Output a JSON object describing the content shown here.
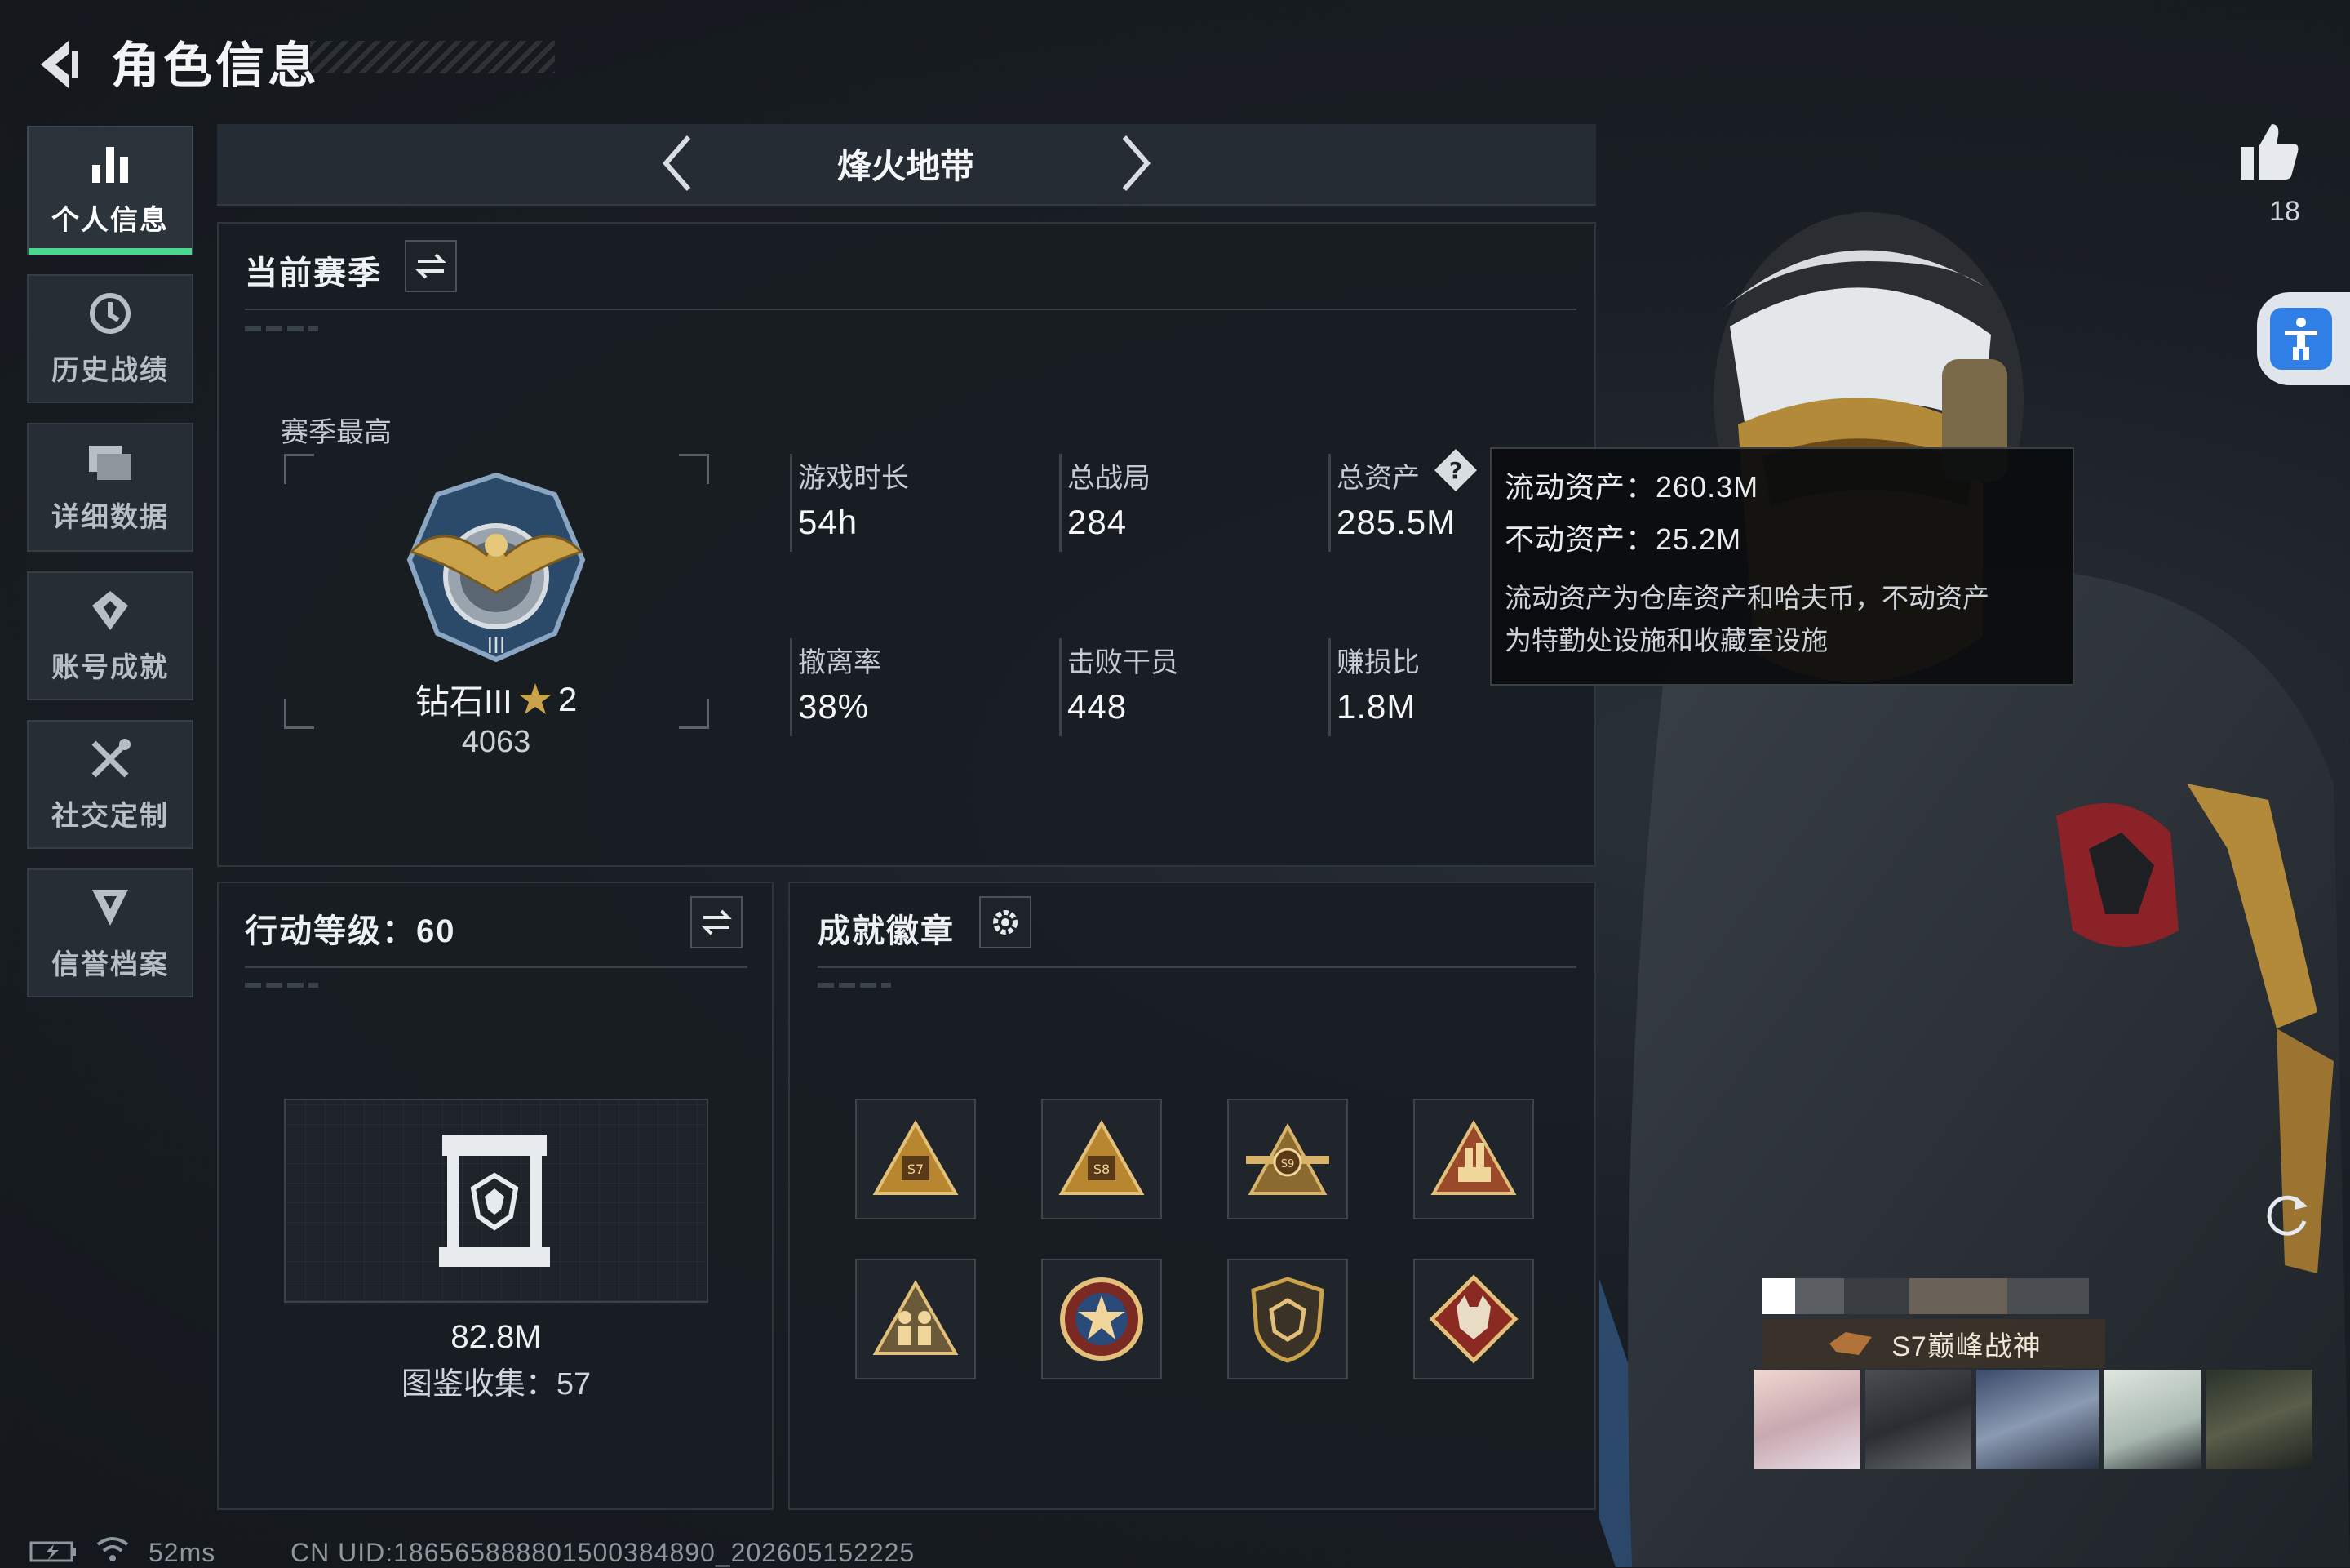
{
  "header": {
    "title": "角色信息"
  },
  "sidebar": {
    "items": [
      {
        "label": "个人信息",
        "icon": "bar-chart-icon",
        "active": true
      },
      {
        "label": "历史战绩",
        "icon": "history-icon",
        "active": false
      },
      {
        "label": "详细数据",
        "icon": "folder-icon",
        "active": false
      },
      {
        "label": "账号成就",
        "icon": "achievement-icon",
        "active": false
      },
      {
        "label": "社交定制",
        "icon": "tools-icon",
        "active": false
      },
      {
        "label": "信誉档案",
        "icon": "credit-icon",
        "active": false
      }
    ]
  },
  "mode_selector": {
    "current": "烽火地带"
  },
  "season_panel": {
    "title": "当前赛季",
    "highest_label": "赛季最高",
    "rank_name": "钻石III",
    "rank_stars": "2",
    "rank_points": "4063",
    "stats": [
      {
        "label": "游戏时长",
        "value": "54h"
      },
      {
        "label": "总战局",
        "value": "284"
      },
      {
        "label": "总资产",
        "value": "285.5M"
      },
      {
        "label": "撤离率",
        "value": "38%"
      },
      {
        "label": "击败干员",
        "value": "448"
      },
      {
        "label": "赚损比",
        "value": "1.8M"
      }
    ]
  },
  "tooltip": {
    "liquid_label": "流动资产：",
    "liquid_value": "260.3M",
    "fixed_label": "不动资产：",
    "fixed_value": "25.2M",
    "desc_line1": "流动资产为仓库资产和哈夫币，不动资产",
    "desc_line2": "为特勤处设施和收藏室设施"
  },
  "action_panel": {
    "title": "行动等级：60",
    "value": "82.8M",
    "collection_label": "图鉴收集：",
    "collection_count": "57"
  },
  "badge_panel": {
    "title": "成就徽章",
    "badges": [
      "s7-badge",
      "s8-badge",
      "s9-badge",
      "hand-badge",
      "soldiers-badge",
      "star-emblem-badge",
      "shield-badge",
      "wolf-badge"
    ]
  },
  "profile": {
    "likes": "18",
    "title_badge": "S7巅峰战神"
  },
  "footer": {
    "ping": "52ms",
    "uid": "CN UID:186565888801500384890_202605152225"
  },
  "colors": {
    "accent_green": "#4ad88e",
    "access_blue": "#2f7fe6",
    "gold": "#c9a24a"
  }
}
